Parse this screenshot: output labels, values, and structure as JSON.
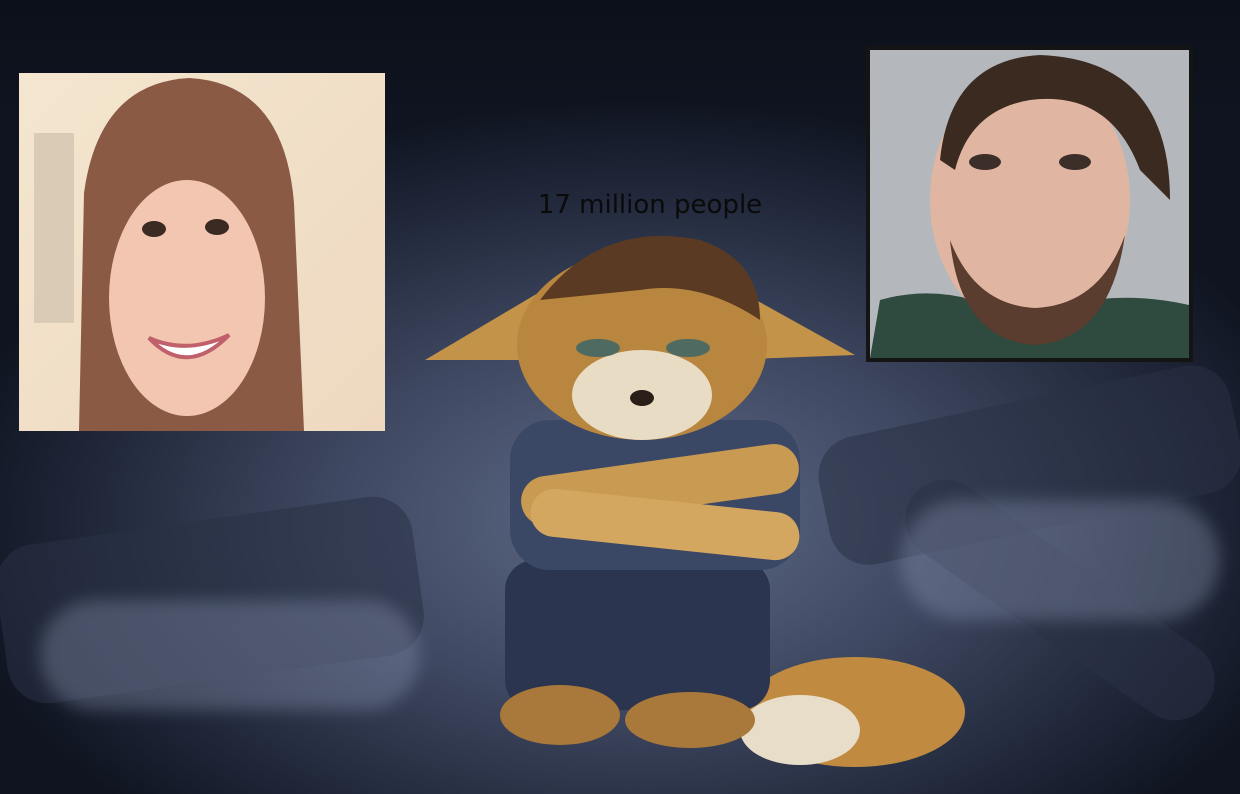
{
  "caption": "17 million people",
  "palette": {
    "background_dark": "#0f1420",
    "background_mid": "#3e4760",
    "fur": "#b8863e",
    "jeans": "#2c3550"
  },
  "images": {
    "left_photo": "smiling-woman-portrait",
    "right_photo": "bearded-man-mugshot",
    "center": "sad-fox-character-arms-crossed"
  }
}
